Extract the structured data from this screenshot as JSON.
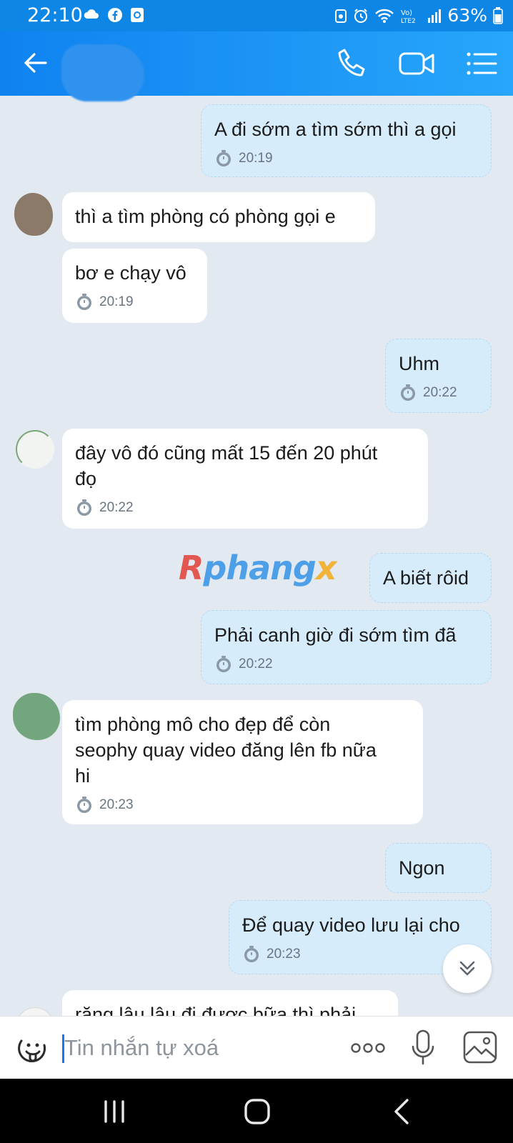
{
  "status_bar": {
    "time": "22:10",
    "battery": "63%",
    "network": "Vo) LTE2"
  },
  "header": {
    "contact_name": ""
  },
  "messages": [
    {
      "dir": "out",
      "text": "A đi sớm a tìm sớm thì a gọi",
      "time": "20:19"
    },
    {
      "dir": "in",
      "text": "thì a tìm phòng có phòng gọi e",
      "time": ""
    },
    {
      "dir": "in",
      "text": "bơ e chạy vô",
      "time": "20:19"
    },
    {
      "dir": "out",
      "text": "Uhm",
      "time": "20:22"
    },
    {
      "dir": "in",
      "text": "đây vô đó cũng mất 15 đến 20 phút\nđọ",
      "time": "20:22"
    },
    {
      "dir": "out",
      "text": "A biết rôid",
      "time": ""
    },
    {
      "dir": "out",
      "text": "Phải canh giờ đi sớm tìm đã",
      "time": "20:22"
    },
    {
      "dir": "in",
      "text": "tìm phòng mô cho đẹp để còn\nseophy quay video đăng lên fb nữa\nhi",
      "time": "20:23"
    },
    {
      "dir": "out",
      "text": "Ngon",
      "time": ""
    },
    {
      "dir": "out",
      "text": "Để quay video lưu lại cho",
      "time": "20:23"
    },
    {
      "dir": "in",
      "text": "răng lâu lâu đi được bữa thì phải",
      "time": ""
    }
  ],
  "watermark": {
    "part1": "R",
    "part2": "phang",
    "part3": "x"
  },
  "input": {
    "placeholder": "Tin nhắn tự xoá",
    "value": ""
  },
  "colors": {
    "header": "#1a8ff0",
    "outgoing_bubble": "#d6ecfb",
    "incoming_bubble": "#ffffff",
    "chat_bg": "#e2e9f1"
  }
}
